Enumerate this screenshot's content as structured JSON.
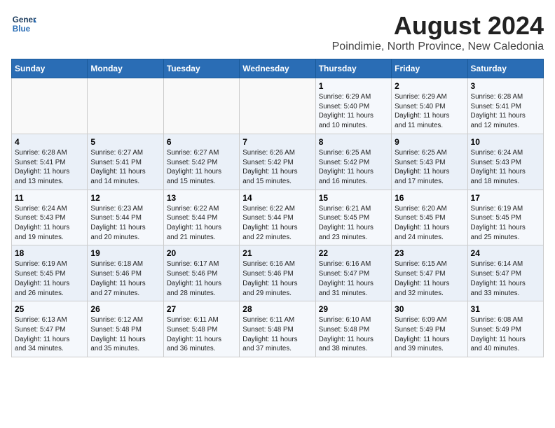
{
  "header": {
    "logo_line1": "General",
    "logo_line2": "Blue",
    "title": "August 2024",
    "subtitle": "Poindimie, North Province, New Caledonia"
  },
  "days_of_week": [
    "Sunday",
    "Monday",
    "Tuesday",
    "Wednesday",
    "Thursday",
    "Friday",
    "Saturday"
  ],
  "weeks": [
    [
      {
        "day": "",
        "info": ""
      },
      {
        "day": "",
        "info": ""
      },
      {
        "day": "",
        "info": ""
      },
      {
        "day": "",
        "info": ""
      },
      {
        "day": "1",
        "info": "Sunrise: 6:29 AM\nSunset: 5:40 PM\nDaylight: 11 hours\nand 10 minutes."
      },
      {
        "day": "2",
        "info": "Sunrise: 6:29 AM\nSunset: 5:40 PM\nDaylight: 11 hours\nand 11 minutes."
      },
      {
        "day": "3",
        "info": "Sunrise: 6:28 AM\nSunset: 5:41 PM\nDaylight: 11 hours\nand 12 minutes."
      }
    ],
    [
      {
        "day": "4",
        "info": "Sunrise: 6:28 AM\nSunset: 5:41 PM\nDaylight: 11 hours\nand 13 minutes."
      },
      {
        "day": "5",
        "info": "Sunrise: 6:27 AM\nSunset: 5:41 PM\nDaylight: 11 hours\nand 14 minutes."
      },
      {
        "day": "6",
        "info": "Sunrise: 6:27 AM\nSunset: 5:42 PM\nDaylight: 11 hours\nand 15 minutes."
      },
      {
        "day": "7",
        "info": "Sunrise: 6:26 AM\nSunset: 5:42 PM\nDaylight: 11 hours\nand 15 minutes."
      },
      {
        "day": "8",
        "info": "Sunrise: 6:25 AM\nSunset: 5:42 PM\nDaylight: 11 hours\nand 16 minutes."
      },
      {
        "day": "9",
        "info": "Sunrise: 6:25 AM\nSunset: 5:43 PM\nDaylight: 11 hours\nand 17 minutes."
      },
      {
        "day": "10",
        "info": "Sunrise: 6:24 AM\nSunset: 5:43 PM\nDaylight: 11 hours\nand 18 minutes."
      }
    ],
    [
      {
        "day": "11",
        "info": "Sunrise: 6:24 AM\nSunset: 5:43 PM\nDaylight: 11 hours\nand 19 minutes."
      },
      {
        "day": "12",
        "info": "Sunrise: 6:23 AM\nSunset: 5:44 PM\nDaylight: 11 hours\nand 20 minutes."
      },
      {
        "day": "13",
        "info": "Sunrise: 6:22 AM\nSunset: 5:44 PM\nDaylight: 11 hours\nand 21 minutes."
      },
      {
        "day": "14",
        "info": "Sunrise: 6:22 AM\nSunset: 5:44 PM\nDaylight: 11 hours\nand 22 minutes."
      },
      {
        "day": "15",
        "info": "Sunrise: 6:21 AM\nSunset: 5:45 PM\nDaylight: 11 hours\nand 23 minutes."
      },
      {
        "day": "16",
        "info": "Sunrise: 6:20 AM\nSunset: 5:45 PM\nDaylight: 11 hours\nand 24 minutes."
      },
      {
        "day": "17",
        "info": "Sunrise: 6:19 AM\nSunset: 5:45 PM\nDaylight: 11 hours\nand 25 minutes."
      }
    ],
    [
      {
        "day": "18",
        "info": "Sunrise: 6:19 AM\nSunset: 5:45 PM\nDaylight: 11 hours\nand 26 minutes."
      },
      {
        "day": "19",
        "info": "Sunrise: 6:18 AM\nSunset: 5:46 PM\nDaylight: 11 hours\nand 27 minutes."
      },
      {
        "day": "20",
        "info": "Sunrise: 6:17 AM\nSunset: 5:46 PM\nDaylight: 11 hours\nand 28 minutes."
      },
      {
        "day": "21",
        "info": "Sunrise: 6:16 AM\nSunset: 5:46 PM\nDaylight: 11 hours\nand 29 minutes."
      },
      {
        "day": "22",
        "info": "Sunrise: 6:16 AM\nSunset: 5:47 PM\nDaylight: 11 hours\nand 31 minutes."
      },
      {
        "day": "23",
        "info": "Sunrise: 6:15 AM\nSunset: 5:47 PM\nDaylight: 11 hours\nand 32 minutes."
      },
      {
        "day": "24",
        "info": "Sunrise: 6:14 AM\nSunset: 5:47 PM\nDaylight: 11 hours\nand 33 minutes."
      }
    ],
    [
      {
        "day": "25",
        "info": "Sunrise: 6:13 AM\nSunset: 5:47 PM\nDaylight: 11 hours\nand 34 minutes."
      },
      {
        "day": "26",
        "info": "Sunrise: 6:12 AM\nSunset: 5:48 PM\nDaylight: 11 hours\nand 35 minutes."
      },
      {
        "day": "27",
        "info": "Sunrise: 6:11 AM\nSunset: 5:48 PM\nDaylight: 11 hours\nand 36 minutes."
      },
      {
        "day": "28",
        "info": "Sunrise: 6:11 AM\nSunset: 5:48 PM\nDaylight: 11 hours\nand 37 minutes."
      },
      {
        "day": "29",
        "info": "Sunrise: 6:10 AM\nSunset: 5:48 PM\nDaylight: 11 hours\nand 38 minutes."
      },
      {
        "day": "30",
        "info": "Sunrise: 6:09 AM\nSunset: 5:49 PM\nDaylight: 11 hours\nand 39 minutes."
      },
      {
        "day": "31",
        "info": "Sunrise: 6:08 AM\nSunset: 5:49 PM\nDaylight: 11 hours\nand 40 minutes."
      }
    ]
  ]
}
